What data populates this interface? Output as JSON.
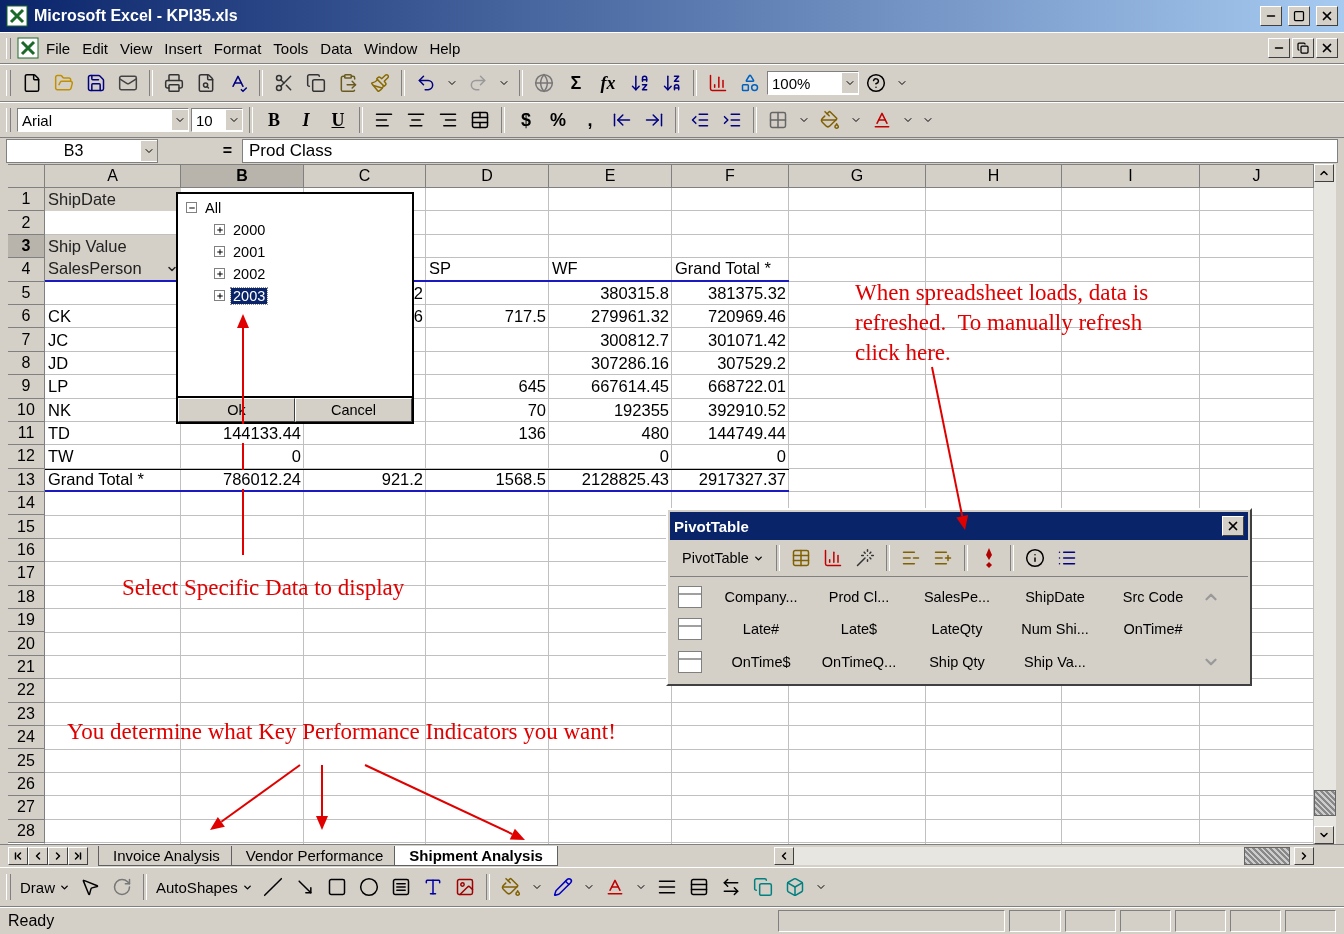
{
  "window": {
    "title": "Microsoft Excel - KPI35.xls"
  },
  "menu": [
    "File",
    "Edit",
    "View",
    "Insert",
    "Format",
    "Tools",
    "Data",
    "Window",
    "Help"
  ],
  "standard_toolbar": [
    {
      "kind": "new"
    },
    {
      "kind": "open"
    },
    {
      "kind": "save"
    },
    {
      "kind": "mail"
    },
    {
      "kind": "sep"
    },
    {
      "kind": "print"
    },
    {
      "kind": "preview"
    },
    {
      "kind": "spell"
    },
    {
      "kind": "sep"
    },
    {
      "kind": "cut"
    },
    {
      "kind": "copy"
    },
    {
      "kind": "paste"
    },
    {
      "kind": "brush"
    },
    {
      "kind": "sep"
    },
    {
      "kind": "undo"
    },
    {
      "kind": "caret"
    },
    {
      "kind": "redo"
    },
    {
      "kind": "caret"
    },
    {
      "kind": "sep"
    },
    {
      "kind": "globe"
    },
    {
      "kind": "glyph",
      "label": "Σ"
    },
    {
      "kind": "function",
      "label": "fx"
    },
    {
      "kind": "sortasc"
    },
    {
      "kind": "sortdesc"
    },
    {
      "kind": "sep"
    },
    {
      "kind": "chart"
    },
    {
      "kind": "drawing"
    },
    {
      "kind": "combo",
      "value": "100%"
    },
    {
      "kind": "help"
    },
    {
      "kind": "caret"
    }
  ],
  "formatting_toolbar": [
    {
      "kind": "combo",
      "value": "Arial"
    },
    {
      "kind": "combo",
      "value": "10"
    },
    {
      "kind": "sep"
    },
    {
      "kind": "bold",
      "label": "B"
    },
    {
      "kind": "italic",
      "label": "I"
    },
    {
      "kind": "underline",
      "label": "U"
    },
    {
      "kind": "sep"
    },
    {
      "kind": "alignleft"
    },
    {
      "kind": "aligncenter"
    },
    {
      "kind": "alignright"
    },
    {
      "kind": "merge"
    },
    {
      "kind": "sep"
    },
    {
      "kind": "glyph",
      "label": "$"
    },
    {
      "kind": "glyph",
      "label": "%"
    },
    {
      "kind": "glyph",
      "label": ","
    },
    {
      "kind": "incdecimal"
    },
    {
      "kind": "decdecimal"
    },
    {
      "kind": "sep"
    },
    {
      "kind": "outdent"
    },
    {
      "kind": "indent"
    },
    {
      "kind": "sep"
    },
    {
      "kind": "borders"
    },
    {
      "kind": "caret"
    },
    {
      "kind": "fill"
    },
    {
      "kind": "caret"
    },
    {
      "kind": "fontcolor"
    },
    {
      "kind": "caret"
    },
    {
      "kind": "caret"
    }
  ],
  "formula_bar": {
    "name_box": "B3",
    "equals": "=",
    "value": "Prod Class"
  },
  "columns": [
    {
      "label": "A",
      "selected": false
    },
    {
      "label": "B",
      "selected": true
    },
    {
      "label": "C",
      "selected": false
    },
    {
      "label": "D",
      "selected": false
    },
    {
      "label": "E",
      "selected": false
    },
    {
      "label": "F",
      "selected": false
    },
    {
      "label": "G",
      "selected": false
    },
    {
      "label": "H",
      "selected": false
    },
    {
      "label": "I",
      "selected": false
    },
    {
      "label": "J",
      "selected": false
    }
  ],
  "rows": [
    {
      "number": "1",
      "selected": false,
      "kind": "filter",
      "cells": [
        "ShipDate"
      ]
    },
    {
      "number": "2",
      "selected": false,
      "kind": "blank",
      "cells": []
    },
    {
      "number": "3",
      "selected": true,
      "kind": "datafield",
      "cells": [
        "Ship Value"
      ]
    },
    {
      "number": "4",
      "selected": false,
      "kind": "header",
      "cells": [
        "SalesPerson",
        null,
        null,
        "SP",
        "WF",
        "Grand Total *"
      ]
    },
    {
      "number": "5",
      "selected": false,
      "kind": "data",
      "cells": [
        null,
        null,
        "2",
        null,
        "380315.8",
        "381375.32"
      ]
    },
    {
      "number": "6",
      "selected": false,
      "kind": "data",
      "cells": [
        "CK",
        null,
        "6",
        "717.5",
        "279961.32",
        "720969.46"
      ]
    },
    {
      "number": "7",
      "selected": false,
      "kind": "data",
      "cells": [
        "JC",
        null,
        null,
        null,
        "300812.7",
        "301071.42"
      ]
    },
    {
      "number": "8",
      "selected": false,
      "kind": "data",
      "cells": [
        "JD",
        null,
        null,
        null,
        "307286.16",
        "307529.2"
      ]
    },
    {
      "number": "9",
      "selected": false,
      "kind": "data",
      "cells": [
        "LP",
        null,
        null,
        "645",
        "667614.45",
        "668722.01"
      ]
    },
    {
      "number": "10",
      "selected": false,
      "kind": "data",
      "cells": [
        "NK",
        null,
        null,
        "70",
        "192355",
        "392910.52"
      ]
    },
    {
      "number": "11",
      "selected": false,
      "kind": "data",
      "cells": [
        "TD",
        "144133.44",
        null,
        "136",
        "480",
        "144749.44"
      ]
    },
    {
      "number": "12",
      "selected": false,
      "kind": "data",
      "cells": [
        "TW",
        "0",
        null,
        null,
        "0",
        "0"
      ]
    },
    {
      "number": "13",
      "selected": false,
      "kind": "total",
      "cells": [
        "Grand Total *",
        "786012.24",
        "921.2",
        "1568.5",
        "2128825.43",
        "2917327.37"
      ]
    },
    {
      "number": "14",
      "selected": false,
      "kind": "blank",
      "cells": []
    },
    {
      "number": "15",
      "selected": false,
      "kind": "blank",
      "cells": []
    },
    {
      "number": "16",
      "selected": false,
      "kind": "blank",
      "cells": []
    },
    {
      "number": "17",
      "selected": false,
      "kind": "blank",
      "cells": []
    },
    {
      "number": "18",
      "selected": false,
      "kind": "blank",
      "cells": []
    },
    {
      "number": "19",
      "selected": false,
      "kind": "blank",
      "cells": []
    },
    {
      "number": "20",
      "selected": false,
      "kind": "blank",
      "cells": []
    },
    {
      "number": "21",
      "selected": false,
      "kind": "blank",
      "cells": []
    },
    {
      "number": "22",
      "selected": false,
      "kind": "blank",
      "cells": []
    },
    {
      "number": "23",
      "selected": false,
      "kind": "blank",
      "cells": []
    },
    {
      "number": "24",
      "selected": false,
      "kind": "blank",
      "cells": []
    },
    {
      "number": "25",
      "selected": false,
      "kind": "blank",
      "cells": []
    },
    {
      "number": "26",
      "selected": false,
      "kind": "blank",
      "cells": []
    },
    {
      "number": "27",
      "selected": false,
      "kind": "blank",
      "cells": []
    },
    {
      "number": "28",
      "selected": false,
      "kind": "blank",
      "cells": []
    }
  ],
  "filter_popup": {
    "tree": [
      {
        "label": "All",
        "expanded": true,
        "selected": false,
        "children": [
          {
            "label": "2000",
            "expanded": false,
            "selected": false
          },
          {
            "label": "2001",
            "expanded": false,
            "selected": false
          },
          {
            "label": "2002",
            "expanded": false,
            "selected": false
          },
          {
            "label": "2003",
            "expanded": false,
            "selected": true
          }
        ]
      }
    ],
    "buttons": [
      "Ok",
      "Cancel"
    ]
  },
  "pivot_toolbar": {
    "title": "PivotTable",
    "menu": "PivotTable",
    "field_rows": [
      [
        "Company...",
        "Prod Cl...",
        "SalesPe...",
        "ShipDate",
        "Src Code"
      ],
      [
        "Late#",
        "Late$",
        "LateQty",
        "Num Shi...",
        "OnTime#"
      ],
      [
        "OnTime$",
        "OnTimeQ...",
        "Ship Qty",
        "Ship Va..."
      ]
    ]
  },
  "annotations": [
    "When spreadsheet loads, data is refreshed.  To manually refresh click here.",
    "Select Specific Data to display",
    "You determine what Key Performance Indicators you want!"
  ],
  "sheet_tabs": [
    {
      "label": "Invoice Analysis",
      "selected": false
    },
    {
      "label": "Vendor Performance",
      "selected": false
    },
    {
      "label": "Shipment Analysis",
      "selected": true
    }
  ],
  "drawing_toolbar": [
    {
      "kind": "menu",
      "label": "Draw"
    },
    {
      "kind": "pointer"
    },
    {
      "kind": "rotate"
    },
    {
      "kind": "sep"
    },
    {
      "kind": "menu",
      "label": "AutoShapes"
    },
    {
      "kind": "line"
    },
    {
      "kind": "arrow"
    },
    {
      "kind": "rect"
    },
    {
      "kind": "oval"
    },
    {
      "kind": "textbox"
    },
    {
      "kind": "wordart"
    },
    {
      "kind": "clipart"
    },
    {
      "kind": "sep"
    },
    {
      "kind": "fill"
    },
    {
      "kind": "caret"
    },
    {
      "kind": "linecolor"
    },
    {
      "kind": "caret"
    },
    {
      "kind": "fontcolor"
    },
    {
      "kind": "caret"
    },
    {
      "kind": "linestyle"
    },
    {
      "kind": "dashstyle"
    },
    {
      "kind": "arrowstyle"
    },
    {
      "kind": "shadow"
    },
    {
      "kind": "threed"
    },
    {
      "kind": "caret"
    }
  ],
  "status_bar": {
    "text": "Ready"
  }
}
